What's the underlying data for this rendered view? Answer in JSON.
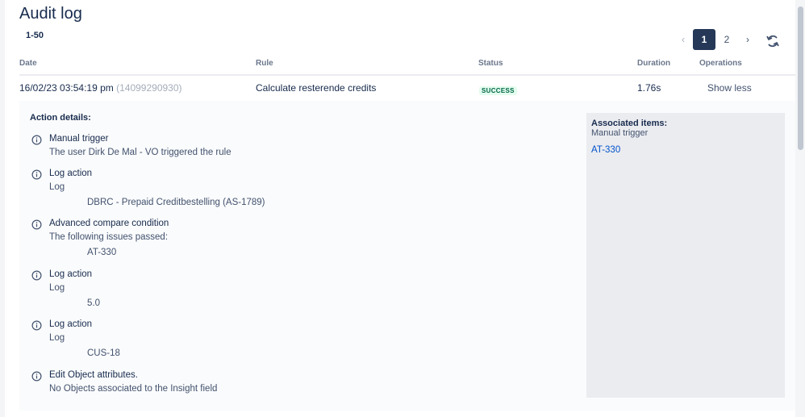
{
  "page": {
    "title": "Audit log",
    "range": "1-50"
  },
  "pagination": {
    "prev": "‹",
    "pages": [
      "1",
      "2"
    ],
    "next": "›",
    "current": "1"
  },
  "table": {
    "headers": {
      "date": "Date",
      "rule": "Rule",
      "status": "Status",
      "duration": "Duration",
      "operations": "Operations"
    },
    "row": {
      "date": "16/02/23 03:54:19 pm",
      "date_id": "(14099290930)",
      "rule": "Calculate resterende credits",
      "status": "SUCCESS",
      "duration": "1.76s",
      "operation": "Show less"
    }
  },
  "details": {
    "title": "Action details:",
    "entries": [
      {
        "icon": "info-icon",
        "heading": "Manual trigger",
        "sub": "The user Dirk De Mal - VO triggered the rule",
        "value": ""
      },
      {
        "icon": "info-icon",
        "heading": "Log action",
        "sub": "Log",
        "value": "DBRC - Prepaid Creditbestelling (AS-1789)"
      },
      {
        "icon": "info-icon",
        "heading": "Advanced compare condition",
        "sub": "The following issues passed:",
        "value": "AT-330"
      },
      {
        "icon": "info-icon",
        "heading": "Log action",
        "sub": "Log",
        "value": "5.0"
      },
      {
        "icon": "info-icon",
        "heading": "Log action",
        "sub": "Log",
        "value": "CUS-18"
      },
      {
        "icon": "info-icon",
        "heading": "Edit Object attributes.",
        "sub": "No Objects associated to the Insight field",
        "value": ""
      }
    ],
    "associated": {
      "title": "Associated items:",
      "trigger": "Manual trigger",
      "link": "AT-330"
    }
  },
  "colors": {
    "accent": "#253858",
    "link": "#0052CC",
    "success_text": "#006644",
    "success_bg": "#E3FCEF"
  }
}
